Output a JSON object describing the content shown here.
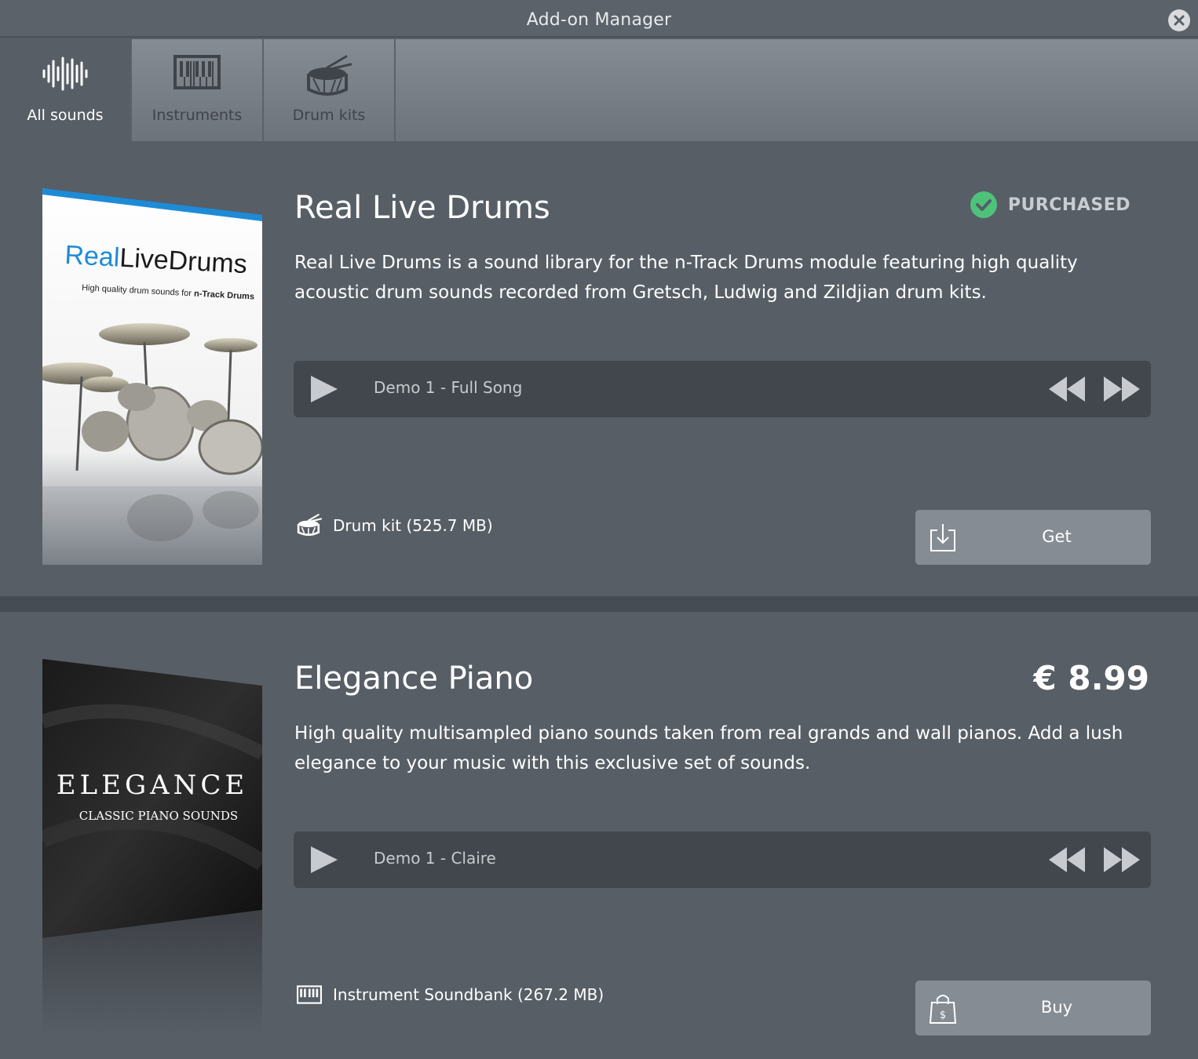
{
  "window": {
    "title": "Add-on Manager"
  },
  "tabs": [
    {
      "label": "All sounds",
      "icon": "waveform-icon",
      "active": true
    },
    {
      "label": "Instruments",
      "icon": "keyboard-icon",
      "active": false
    },
    {
      "label": "Drum kits",
      "icon": "drum-icon",
      "active": false
    }
  ],
  "products": [
    {
      "name": "Real Live Drums",
      "status": "PURCHASED",
      "description": "Real Live Drums is a sound library for the n-Track Drums module featuring high quality acoustic drum sounds recorded from Gretsch, Ludwig and Zildjian drum kits.",
      "cover": {
        "brand_part1": "Real",
        "brand_part2": "LiveDrums",
        "tagline_prefix": "High quality drum sounds for",
        "tagline_suffix": "n-Track Drums"
      },
      "player": {
        "track": "Demo 1 - Full Song"
      },
      "meta": "Drum kit (525.7 MB)",
      "action": "Get"
    },
    {
      "name": "Elegance Piano",
      "price": "€ 8.99",
      "description": "High quality multisampled piano sounds taken from real grands and wall pianos. Add a lush elegance to your music with this exclusive set of sounds.",
      "cover": {
        "title": "ELEGANCE",
        "subtitle": "CLASSIC PIANO SOUNDS"
      },
      "player": {
        "track": "Demo 1 - Claire"
      },
      "meta": "Instrument Soundbank (267.2 MB)",
      "action": "Buy"
    }
  ],
  "colors": {
    "accent_check": "#4ec27b",
    "brand_blue": "#1e8bd6"
  }
}
